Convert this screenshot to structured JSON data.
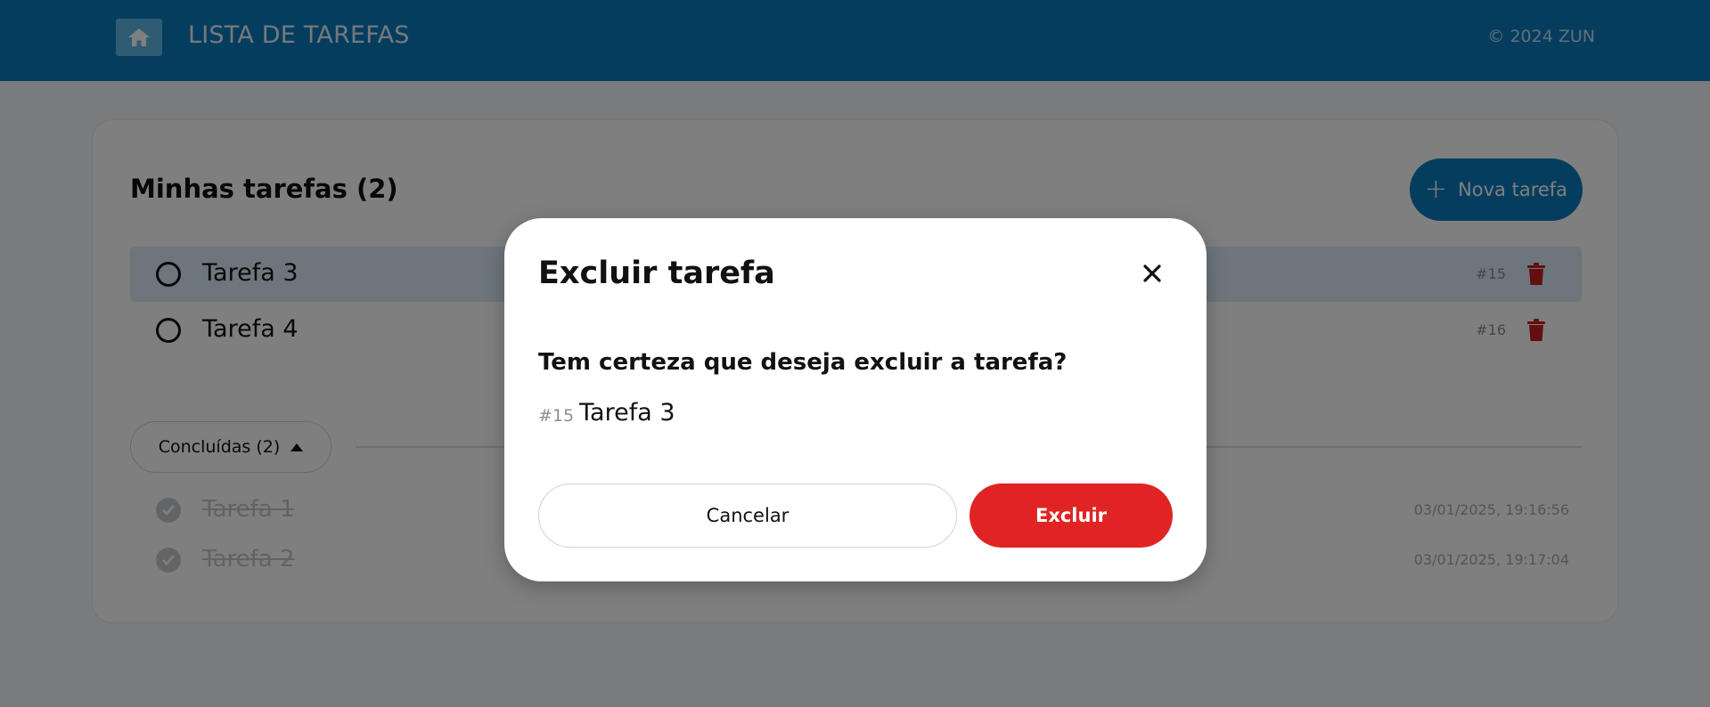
{
  "header": {
    "title": "LISTA DE TAREFAS",
    "copyright": "© 2024 ZUN",
    "home_icon": "home-icon"
  },
  "main": {
    "title": "Minhas tarefas (2)",
    "new_task_button": {
      "icon": "plus-icon",
      "label": "Nova tarefa"
    },
    "tasks": [
      {
        "name": "Tarefa 3",
        "id": "#15",
        "highlighted": true
      },
      {
        "name": "Tarefa 4",
        "id": "#16",
        "highlighted": false
      }
    ],
    "completed_toggle": {
      "label": "Concluídas (2)",
      "icon": "caret-up-icon"
    },
    "completed_tasks": [
      {
        "name": "Tarefa 1",
        "date": "03/01/2025, 19:16:56"
      },
      {
        "name": "Tarefa 2",
        "date": "03/01/2025, 19:17:04"
      }
    ]
  },
  "modal": {
    "title": "Excluir tarefa",
    "question": "Tem certeza que deseja excluir a tarefa?",
    "task_id": "#15",
    "task_name": "Tarefa 3",
    "cancel_label": "Cancelar",
    "delete_label": "Excluir",
    "close_icon": "close-icon"
  },
  "colors": {
    "brand": "#0a7bbd",
    "danger": "#e02424",
    "highlight": "#d9ecf8"
  }
}
